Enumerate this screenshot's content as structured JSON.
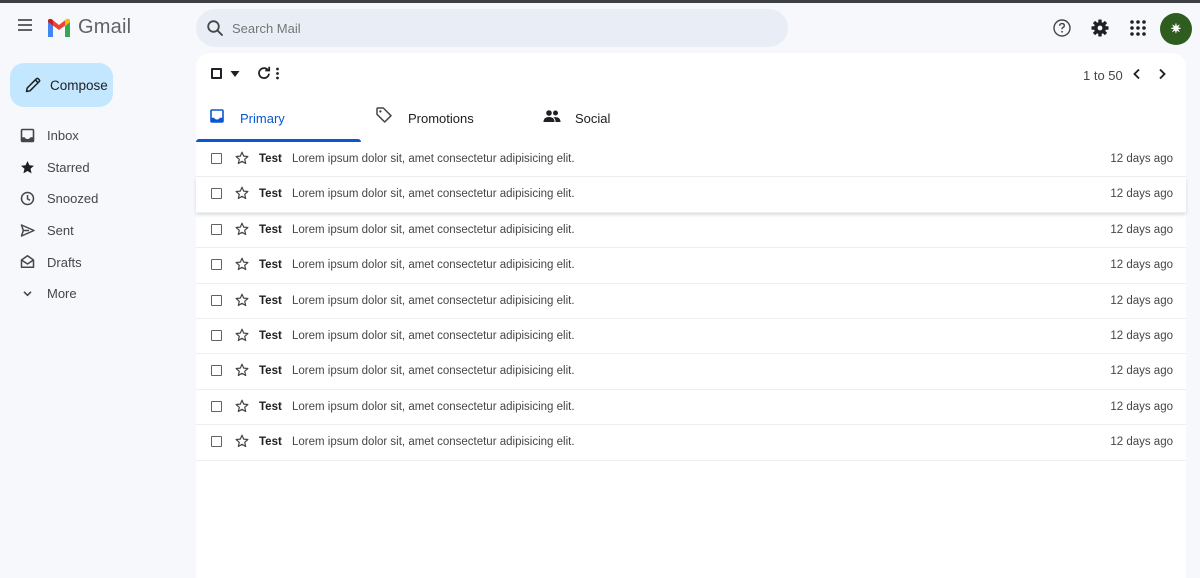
{
  "app": {
    "name": "Gmail",
    "avatar_text": "✷"
  },
  "search": {
    "placeholder": "Search Mail"
  },
  "compose": {
    "label": "Compose"
  },
  "sidebar": {
    "items": [
      {
        "label": "Inbox",
        "icon": "inbox-icon"
      },
      {
        "label": "Starred",
        "icon": "star-icon"
      },
      {
        "label": "Snoozed",
        "icon": "clock-icon"
      },
      {
        "label": "Sent",
        "icon": "send-icon"
      },
      {
        "label": "Drafts",
        "icon": "draft-icon"
      },
      {
        "label": "More",
        "icon": "chevron-down-icon"
      }
    ]
  },
  "toolbar": {
    "pager_text": "1 to 50"
  },
  "tabs": [
    {
      "label": "Primary",
      "icon": "inbox-icon",
      "active": true
    },
    {
      "label": "Promotions",
      "icon": "tag-icon",
      "active": false
    },
    {
      "label": "Social",
      "icon": "people-icon",
      "active": false
    }
  ],
  "emails": [
    {
      "sender": "Test",
      "subject": "Lorem ipsum dolor sit, amet consectetur adipisicing elit.",
      "date": "12 days ago"
    },
    {
      "sender": "Test",
      "subject": "Lorem ipsum dolor sit, amet consectetur adipisicing elit.",
      "date": "12 days ago"
    },
    {
      "sender": "Test",
      "subject": "Lorem ipsum dolor sit, amet consectetur adipisicing elit.",
      "date": "12 days ago"
    },
    {
      "sender": "Test",
      "subject": "Lorem ipsum dolor sit, amet consectetur adipisicing elit.",
      "date": "12 days ago"
    },
    {
      "sender": "Test",
      "subject": "Lorem ipsum dolor sit, amet consectetur adipisicing elit.",
      "date": "12 days ago"
    },
    {
      "sender": "Test",
      "subject": "Lorem ipsum dolor sit, amet consectetur adipisicing elit.",
      "date": "12 days ago"
    },
    {
      "sender": "Test",
      "subject": "Lorem ipsum dolor sit, amet consectetur adipisicing elit.",
      "date": "12 days ago"
    },
    {
      "sender": "Test",
      "subject": "Lorem ipsum dolor sit, amet consectetur adipisicing elit.",
      "date": "12 days ago"
    },
    {
      "sender": "Test",
      "subject": "Lorem ipsum dolor sit, amet consectetur adipisicing elit.",
      "date": "12 days ago"
    }
  ],
  "colors": {
    "accent": "#0b57d0",
    "compose_bg": "#c2e7ff",
    "search_bg": "#e9eef6",
    "avatar_bg": "#2f5d1f"
  }
}
